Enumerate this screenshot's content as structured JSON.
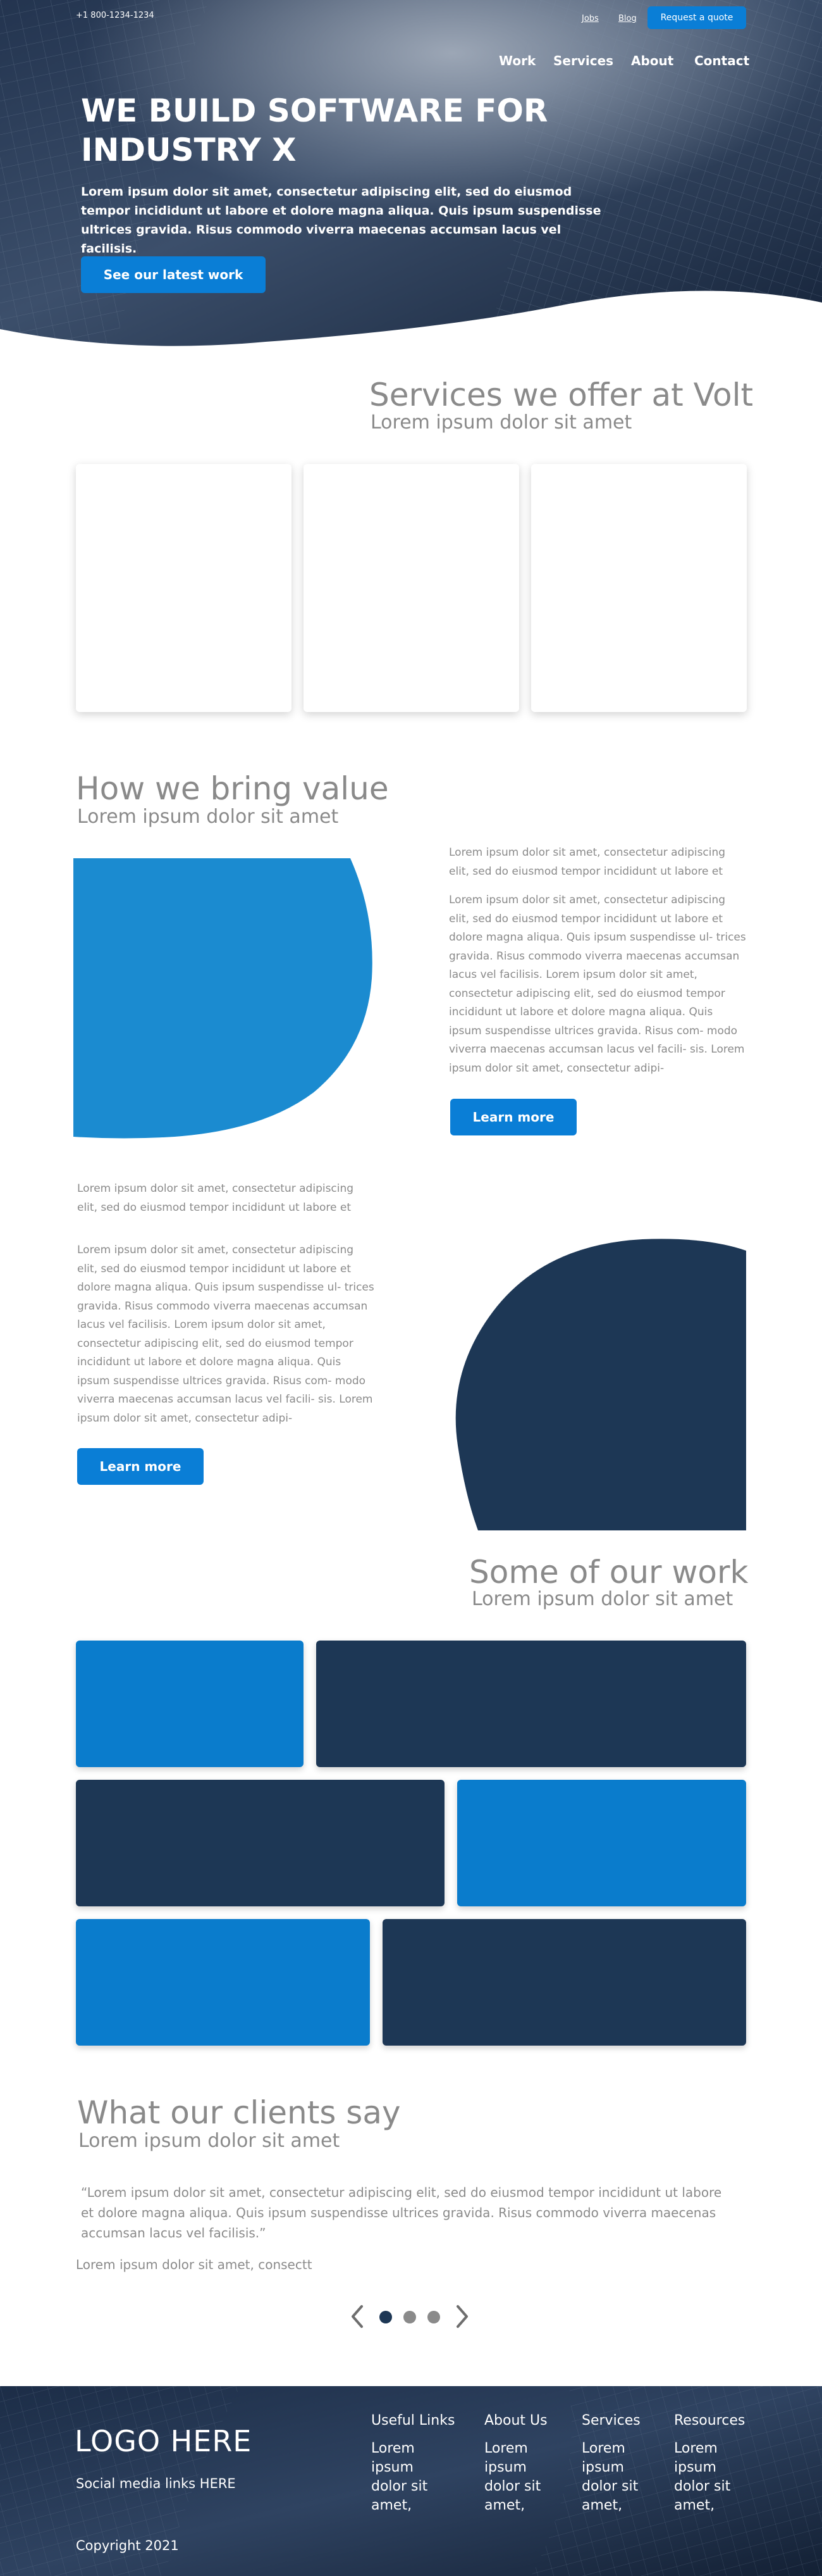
{
  "header": {
    "phone": "+1 800-1234-1234",
    "links": [
      "Jobs",
      "Blog"
    ],
    "quote_button": "Request a quote",
    "nav": [
      "Work",
      "Services",
      "About",
      "Contact"
    ]
  },
  "hero": {
    "title": "WE BUILD SOFTWARE FOR INDUSTRY X",
    "text": "Lorem ipsum dolor sit amet, consectetur adipiscing elit, sed do eiusmod tempor incididunt ut labore et dolore magna aliqua. Quis ipsum suspendisse ultrices gravida. Risus commodo viverra maecenas accumsan lacus vel facilisis.",
    "button": "See our latest work"
  },
  "services": {
    "title": "Services we offer at Volt",
    "subtitle": "Lorem ipsum dolor sit amet"
  },
  "value": {
    "title": "How we bring value",
    "subtitle": "Lorem ipsum dolor sit amet",
    "block1": {
      "intro": "Lorem ipsum dolor sit amet, consectetur adipiscing elit, sed do eiusmod tempor incididunt ut labore et",
      "body": "Lorem ipsum dolor sit amet, consectetur adipiscing elit, sed do eiusmod tempor incididunt ut labore et dolore magna aliqua. Quis ipsum suspendisse ul- trices gravida. Risus commodo viverra maecenas accumsan lacus vel facilisis. Lorem ipsum dolor sit amet, consectetur adipiscing elit, sed do eiusmod tempor incididunt ut labore et dolore magna aliqua. Quis ipsum suspendisse ultrices gravida. Risus com- modo viverra maecenas accumsan lacus vel facili- sis. Lorem ipsum dolor sit amet, consectetur adipi-",
      "button": "Learn more"
    },
    "block2": {
      "intro": "Lorem ipsum dolor sit amet, consectetur adipiscing elit, sed do eiusmod tempor incididunt ut labore et",
      "body": "Lorem ipsum dolor sit amet, consectetur adipiscing elit, sed do eiusmod tempor incididunt ut labore et dolore magna aliqua. Quis ipsum suspendisse ul- trices gravida. Risus commodo viverra maecenas accumsan lacus vel facilisis. Lorem ipsum dolor sit amet, consectetur adipiscing elit, sed do eiusmod tempor incididunt ut labore et dolore magna aliqua. Quis ipsum suspendisse ultrices gravida. Risus com- modo viverra maecenas accumsan lacus vel facili- sis. Lorem ipsum dolor sit amet, consectetur adipi-",
      "button": "Learn more"
    }
  },
  "work": {
    "title": "Some of our work",
    "subtitle": "Lorem ipsum dolor sit amet"
  },
  "testimonials": {
    "title": "What our clients say",
    "subtitle": "Lorem ipsum dolor sit amet",
    "quote": "“Lorem ipsum dolor sit amet, consectetur adipiscing elit, sed do eiusmod tempor incididunt ut labore et dolore magna aliqua. Quis ipsum suspendisse ultrices gravida. Risus commodo viverra maecenas accumsan lacus vel facilisis.”",
    "author": "Lorem ipsum dolor sit amet, consectt"
  },
  "footer": {
    "logo": "LOGO HERE",
    "social": "Social media links HERE",
    "copyright": "Copyright  2021",
    "columns": [
      {
        "heading": "Useful Links",
        "text": "Lorem ipsum dolor sit amet, consecte-"
      },
      {
        "heading": "About Us",
        "text": "Lorem ipsum dolor sit amet, consecte-"
      },
      {
        "heading": "Services",
        "text": "Lorem ipsum dolor sit amet, consecte-"
      },
      {
        "heading": "Resources",
        "text": "Lorem ipsum dolor sit amet, consecte-"
      }
    ]
  },
  "colors": {
    "accent": "#0a7ed6",
    "navy": "#1d3755",
    "text_gray": "#8a8a8a",
    "hero_dark": "#1a2b45"
  }
}
